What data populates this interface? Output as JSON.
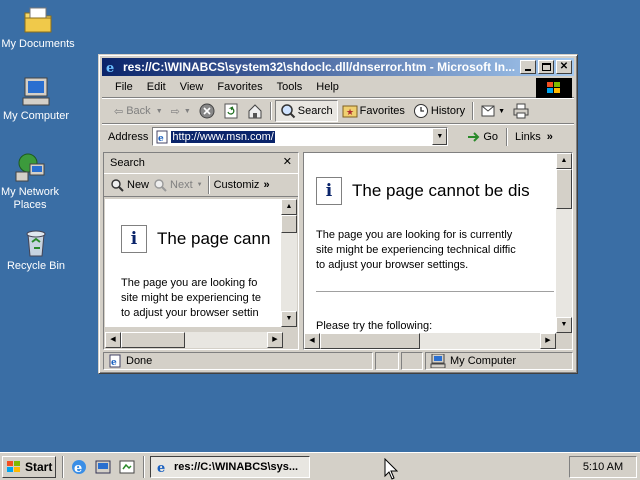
{
  "desktop": {
    "icons": [
      {
        "label_lines": [
          "My Documents"
        ]
      },
      {
        "label_lines": [
          "My Computer"
        ]
      },
      {
        "label_lines": [
          "My Network",
          "Places"
        ]
      },
      {
        "label_lines": [
          "Recycle Bin"
        ]
      }
    ]
  },
  "window": {
    "title": "res://C:\\WINABCS\\system32\\shdoclc.dll/dnserror.htm - Microsoft In...",
    "menu": [
      "File",
      "Edit",
      "View",
      "Favorites",
      "Tools",
      "Help"
    ],
    "toolbar": {
      "back": "Back",
      "search": "Search",
      "favorites": "Favorites",
      "history": "History"
    },
    "address": {
      "label": "Address",
      "url": "http://www.msn.com/",
      "go": "Go",
      "links": "Links"
    },
    "search_pane": {
      "title": "Search",
      "new": "New",
      "next": "Next",
      "customize": "Customiz",
      "heading": "The page cann",
      "lines": [
        "The page you are looking fo",
        "site might be experiencing te",
        "to adjust your browser settin"
      ]
    },
    "main_pane": {
      "heading": "The page cannot be dis",
      "lines": [
        "The page you are looking for is currently",
        "site might be experiencing technical diffic",
        "to adjust your browser settings."
      ],
      "try_text": "Please try the following:"
    },
    "status": {
      "text": "Done",
      "zone": "My Computer"
    }
  },
  "taskbar": {
    "start": "Start",
    "task_title": "res://C:\\WINABCS\\sys...",
    "clock": "5:10 AM"
  },
  "colors": {
    "desktop": "#3a6ea5",
    "title_active": "#0a246a",
    "face": "#d4d0c8"
  }
}
